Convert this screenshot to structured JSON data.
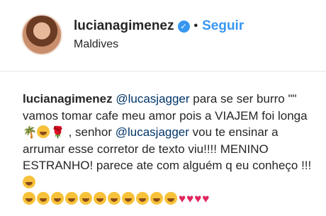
{
  "header": {
    "username": "lucianagimenez",
    "separator": "•",
    "follow_label": "Seguir",
    "location": "Maldives"
  },
  "comment": {
    "username": "lucianagimenez",
    "mention1": "@lucasjagger",
    "text1": " para se ser burro \"\" vamos tomar cafe meu amor pois a VIAJEM foi longa",
    "text2": " , senhor ",
    "mention2": "@lucasjagger",
    "text3": " vou te ensinar a arrumar esse corretor de texto viu!!!! MENINO ESTRANHO! parece ate com alguém q eu conheço !!! "
  },
  "colors": {
    "accent": "#3897f0",
    "mention": "#003569",
    "heart": "#e0245e"
  }
}
